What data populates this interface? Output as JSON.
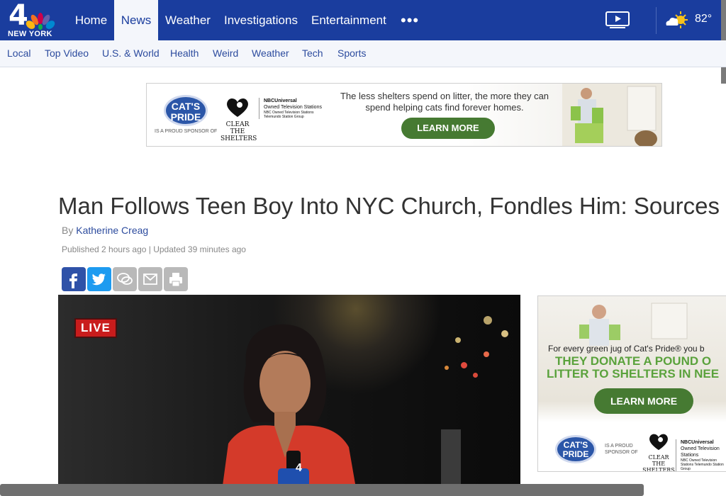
{
  "brand": {
    "logo_number": "4",
    "logo_city": "NEW YORK"
  },
  "topnav": {
    "items": [
      {
        "label": "Home"
      },
      {
        "label": "News",
        "active": true
      },
      {
        "label": "Weather"
      },
      {
        "label": "Investigations"
      },
      {
        "label": "Entertainment"
      }
    ],
    "more_label": "•••",
    "temperature": "82°"
  },
  "subnav": {
    "items": [
      {
        "label": "Local"
      },
      {
        "label": "Top Video"
      },
      {
        "label": "U.S. & World"
      },
      {
        "label": "Health"
      },
      {
        "label": "Weird"
      },
      {
        "label": "Weather"
      },
      {
        "label": "Tech"
      },
      {
        "label": "Sports"
      }
    ]
  },
  "ad_banner": {
    "brand_logo": "CAT'S PRIDE",
    "sponsor_text": "IS A PROUD SPONSOR OF",
    "partner_logo": "CLEAR THE SHELTERS",
    "nbcu_title": "NBCUniversal",
    "nbcu_sub": "Owned Television Stations",
    "nbcu_tiny": "NBC Owned Television Stations Telemundo Station Group",
    "message": "The less shelters spend on litter, the more they can spend helping cats find forever homes.",
    "button": "LEARN MORE"
  },
  "article": {
    "headline": "Man Follows Teen Boy Into NYC Church, Fondles Him: Sources",
    "byline_prefix": "By",
    "author": "Katherine Creag",
    "published": "Published 2 hours ago | Updated 39 minutes ago"
  },
  "share": {
    "icons": [
      "facebook-icon",
      "twitter-icon",
      "comment-icon",
      "email-icon",
      "print-icon"
    ]
  },
  "video": {
    "live_badge": "LIVE",
    "mic_flag": "4"
  },
  "ad_side": {
    "line1": "For every green jug of Cat's Pride® you b",
    "line2a": "THEY DONATE A POUND O",
    "line2b": "LITTER TO SHELTERS IN NEE",
    "button": "LEARN MORE",
    "brand_logo": "CAT'S PRIDE",
    "sponsor_text": "IS A PROUD SPONSOR OF",
    "partner_logo": "CLEAR THE SHELTERS",
    "nbcu_title": "NBCUniversal",
    "nbcu_sub": "Owned Television Stations",
    "nbcu_tiny": "NBC Owned Television Stations Telemundo Station Group"
  },
  "colors": {
    "nav_blue": "#1a3d9e",
    "subnav_bg": "#f4f6fb",
    "live_red": "#c91c1c",
    "cta_green": "#467a32",
    "facebook": "#2f52a8",
    "twitter": "#1d9bf0"
  }
}
